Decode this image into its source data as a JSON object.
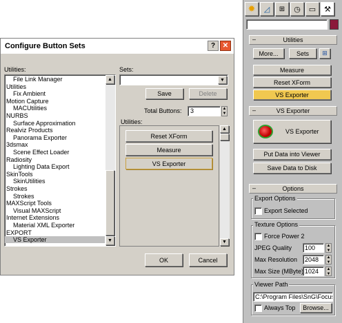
{
  "dialog": {
    "title": "Configure Button Sets",
    "help_glyph": "?",
    "close_glyph": "✕",
    "utilities_label": "Utilities:",
    "sets_label": "Sets:",
    "save_label": "Save",
    "delete_label": "Delete",
    "total_buttons_label": "Total Buttons:",
    "total_buttons_value": "3",
    "utilities_group_label": "Utilities:",
    "assigned_buttons": [
      "Reset XForm",
      "Measure",
      "VS Exporter"
    ],
    "ok_label": "OK",
    "cancel_label": "Cancel",
    "list_items": [
      {
        "text": "File Link Manager",
        "indent": 1
      },
      {
        "text": "Utilities",
        "indent": 0
      },
      {
        "text": "Fix Ambient",
        "indent": 1
      },
      {
        "text": "Motion Capture",
        "indent": 0
      },
      {
        "text": "MACUtilities",
        "indent": 1
      },
      {
        "text": "NURBS",
        "indent": 0
      },
      {
        "text": "Surface Approximation",
        "indent": 1
      },
      {
        "text": "Realviz Products",
        "indent": 0
      },
      {
        "text": "Panorama Exporter",
        "indent": 1
      },
      {
        "text": "3dsmax",
        "indent": 0
      },
      {
        "text": "Scene Effect Loader",
        "indent": 1
      },
      {
        "text": "Radiosity",
        "indent": 0
      },
      {
        "text": "Lighting Data Export",
        "indent": 1
      },
      {
        "text": "SkinTools",
        "indent": 0
      },
      {
        "text": "SkinUtilities",
        "indent": 1
      },
      {
        "text": "Strokes",
        "indent": 0
      },
      {
        "text": "Strokes",
        "indent": 1
      },
      {
        "text": "MAXScript Tools",
        "indent": 0
      },
      {
        "text": "Visual MAXScript",
        "indent": 1
      },
      {
        "text": "Internet Extensions",
        "indent": 0
      },
      {
        "text": "Material XML Exporter",
        "indent": 1
      },
      {
        "text": "EXPORT",
        "indent": 0
      },
      {
        "text": "VS Exporter",
        "indent": 1,
        "selected": true
      }
    ]
  },
  "panel": {
    "tabs": [
      "sun-icon",
      "curve-icon",
      "hierarchy-icon",
      "motion-icon",
      "display-icon",
      "hammer-icon"
    ],
    "swatch_color": "#8b1a3a",
    "utilities_rollout": {
      "title": "Utilities",
      "more_label": "More...",
      "sets_label": "Sets",
      "buttons": [
        "Measure",
        "Reset XForm",
        "VS Exporter"
      ]
    },
    "vs_rollout": {
      "title": "VS Exporter",
      "main_button": "VS Exporter",
      "put_data": "Put Data into Viewer",
      "save_data": "Save Data to Disk"
    },
    "options_rollout": {
      "title": "Options",
      "export_options_label": "Export Options",
      "export_selected": "Export Selected",
      "texture_options_label": "Texture Options",
      "force_power2": "Force Power 2",
      "jpeg_quality_label": "JPEG Quality",
      "jpeg_quality_value": "100",
      "max_resolution_label": "Max Resolution",
      "max_resolution_value": "2048",
      "max_size_label": "Max Size (MByte)",
      "max_size_value": "1024",
      "viewer_path_label": "Viewer Path",
      "viewer_path_value": "C:\\Program Files\\SnG\\Focus S",
      "always_top": "Always Top",
      "browse_label": "Browse..."
    }
  },
  "colors": {
    "dialog_title_bg": "#ffffff",
    "selected_row": "#c0c0c0",
    "highlight_button": "#f0c850",
    "panel_bg": "#c0c0c0",
    "close_button": "#e85830"
  }
}
